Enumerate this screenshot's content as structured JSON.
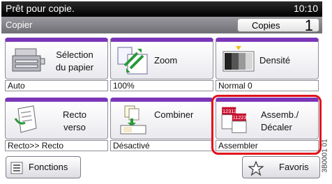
{
  "status": {
    "message": "Prêt pour copie.",
    "time": "10:10"
  },
  "header": {
    "title": "Copier",
    "copies_label": "Copies",
    "copies_value": "1"
  },
  "tiles": [
    {
      "label_line1": "Sélection",
      "label_line2": "du papier",
      "value": "Auto"
    },
    {
      "label_line1": "Zoom",
      "value": "100%"
    },
    {
      "label_line1": "Densité",
      "value": "Normal 0"
    },
    {
      "label_line1": "Recto",
      "label_line2": "verso",
      "value": "Recto>> Recto"
    },
    {
      "label_line1": "Combiner",
      "value": "Désactivé"
    },
    {
      "label_line1": "Assemb./",
      "label_line2": "Décaler",
      "value": "Assembler",
      "icon_text1": "123123",
      "icon_text2": "112233"
    }
  ],
  "bottom": {
    "functions_label": "Fonctions",
    "favorites_label": "Favoris"
  },
  "side_code": "3B0001 01",
  "colors": {
    "accent": "#7a35b8",
    "highlight": "#e0101a"
  }
}
